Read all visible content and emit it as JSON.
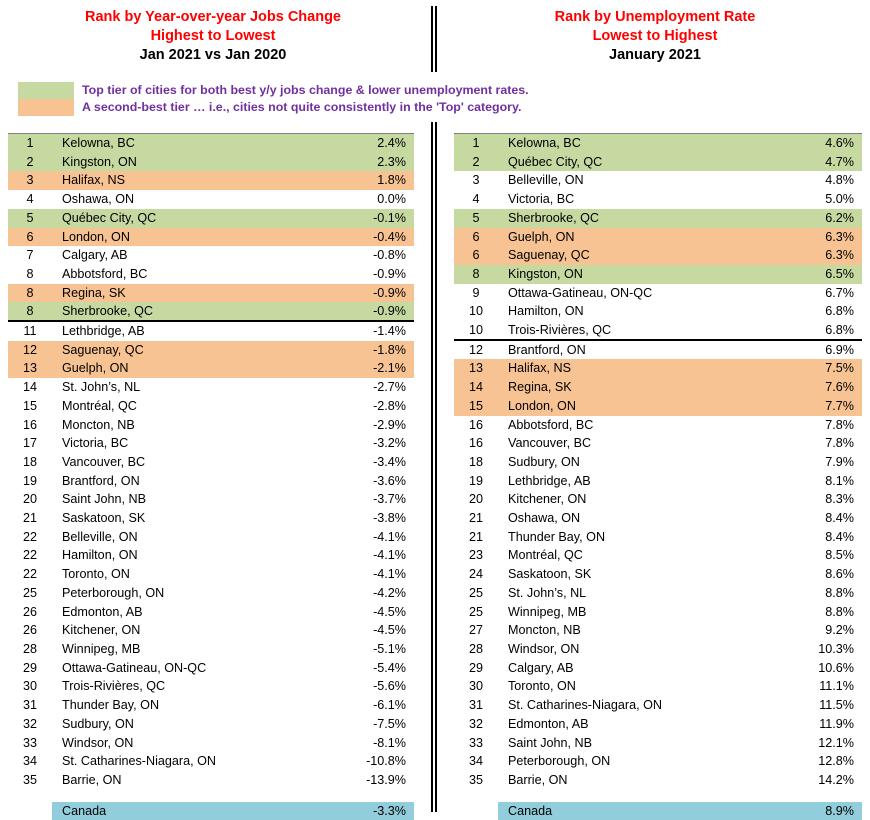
{
  "left_panel": {
    "title_line1": "Rank by Year-over-year Jobs Change",
    "title_line2": "Highest to Lowest",
    "subtitle": "Jan 2021 vs Jan 2020",
    "summary_label": "Canada",
    "summary_value": "-3.3%",
    "rows": [
      {
        "rank": "1",
        "city": "Kelowna, BC",
        "value": "2.4%",
        "tier": "green"
      },
      {
        "rank": "2",
        "city": "Kingston, ON",
        "value": "2.3%",
        "tier": "green"
      },
      {
        "rank": "3",
        "city": "Halifax, NS",
        "value": "1.8%",
        "tier": "orange"
      },
      {
        "rank": "4",
        "city": "Oshawa, ON",
        "value": "0.0%",
        "tier": "none"
      },
      {
        "rank": "5",
        "city": "Québec City, QC",
        "value": "-0.1%",
        "tier": "green"
      },
      {
        "rank": "6",
        "city": "London, ON",
        "value": "-0.4%",
        "tier": "orange"
      },
      {
        "rank": "7",
        "city": "Calgary, AB",
        "value": "-0.8%",
        "tier": "none"
      },
      {
        "rank": "8",
        "city": "Abbotsford, BC",
        "value": "-0.9%",
        "tier": "none"
      },
      {
        "rank": "8",
        "city": "Regina, SK",
        "value": "-0.9%",
        "tier": "orange"
      },
      {
        "rank": "8",
        "city": "Sherbrooke, QC",
        "value": "-0.9%",
        "tier": "green",
        "rule_under": true
      },
      {
        "rank": "11",
        "city": "Lethbridge, AB",
        "value": "-1.4%",
        "tier": "none"
      },
      {
        "rank": "12",
        "city": "Saguenay, QC",
        "value": "-1.8%",
        "tier": "orange"
      },
      {
        "rank": "13",
        "city": "Guelph, ON",
        "value": "-2.1%",
        "tier": "orange"
      },
      {
        "rank": "14",
        "city": "St. John’s, NL",
        "value": "-2.7%",
        "tier": "none"
      },
      {
        "rank": "15",
        "city": "Montréal, QC",
        "value": "-2.8%",
        "tier": "none"
      },
      {
        "rank": "16",
        "city": "Moncton, NB",
        "value": "-2.9%",
        "tier": "none"
      },
      {
        "rank": "17",
        "city": "Victoria, BC",
        "value": "-3.2%",
        "tier": "none"
      },
      {
        "rank": "18",
        "city": "Vancouver, BC",
        "value": "-3.4%",
        "tier": "none"
      },
      {
        "rank": "19",
        "city": "Brantford, ON",
        "value": "-3.6%",
        "tier": "none"
      },
      {
        "rank": "20",
        "city": "Saint John, NB",
        "value": "-3.7%",
        "tier": "none"
      },
      {
        "rank": "21",
        "city": "Saskatoon, SK",
        "value": "-3.8%",
        "tier": "none"
      },
      {
        "rank": "22",
        "city": "Belleville, ON",
        "value": "-4.1%",
        "tier": "none"
      },
      {
        "rank": "22",
        "city": "Hamilton, ON",
        "value": "-4.1%",
        "tier": "none"
      },
      {
        "rank": "22",
        "city": "Toronto, ON",
        "value": "-4.1%",
        "tier": "none"
      },
      {
        "rank": "25",
        "city": "Peterborough, ON",
        "value": "-4.2%",
        "tier": "none"
      },
      {
        "rank": "26",
        "city": "Edmonton, AB",
        "value": "-4.5%",
        "tier": "none"
      },
      {
        "rank": "26",
        "city": "Kitchener, ON",
        "value": "-4.5%",
        "tier": "none"
      },
      {
        "rank": "28",
        "city": "Winnipeg, MB",
        "value": "-5.1%",
        "tier": "none"
      },
      {
        "rank": "29",
        "city": "Ottawa-Gatineau, ON-QC",
        "value": "-5.4%",
        "tier": "none"
      },
      {
        "rank": "30",
        "city": "Trois-Rivières, QC",
        "value": "-5.6%",
        "tier": "none"
      },
      {
        "rank": "31",
        "city": "Thunder Bay, ON",
        "value": "-6.1%",
        "tier": "none"
      },
      {
        "rank": "32",
        "city": "Sudbury, ON",
        "value": "-7.5%",
        "tier": "none"
      },
      {
        "rank": "33",
        "city": "Windsor, ON",
        "value": "-8.1%",
        "tier": "none"
      },
      {
        "rank": "34",
        "city": "St. Catharines-Niagara, ON",
        "value": "-10.8%",
        "tier": "none"
      },
      {
        "rank": "35",
        "city": "Barrie, ON",
        "value": "-13.9%",
        "tier": "none"
      }
    ]
  },
  "right_panel": {
    "title_line1": "Rank by Unemployment Rate",
    "title_line2": "Lowest to Highest",
    "subtitle": "January 2021",
    "summary_label": "Canada",
    "summary_value": "8.9%",
    "rows": [
      {
        "rank": "1",
        "city": "Kelowna, BC",
        "value": "4.6%",
        "tier": "green"
      },
      {
        "rank": "2",
        "city": "Québec City, QC",
        "value": "4.7%",
        "tier": "green"
      },
      {
        "rank": "3",
        "city": "Belleville, ON",
        "value": "4.8%",
        "tier": "none"
      },
      {
        "rank": "4",
        "city": "Victoria, BC",
        "value": "5.0%",
        "tier": "none"
      },
      {
        "rank": "5",
        "city": "Sherbrooke, QC",
        "value": "6.2%",
        "tier": "green"
      },
      {
        "rank": "6",
        "city": "Guelph, ON",
        "value": "6.3%",
        "tier": "orange"
      },
      {
        "rank": "6",
        "city": "Saguenay, QC",
        "value": "6.3%",
        "tier": "orange"
      },
      {
        "rank": "8",
        "city": "Kingston, ON",
        "value": "6.5%",
        "tier": "green"
      },
      {
        "rank": "9",
        "city": "Ottawa-Gatineau, ON-QC",
        "value": "6.7%",
        "tier": "none"
      },
      {
        "rank": "10",
        "city": "Hamilton, ON",
        "value": "6.8%",
        "tier": "none"
      },
      {
        "rank": "10",
        "city": "Trois-Rivières, QC",
        "value": "6.8%",
        "tier": "none",
        "rule_under": true
      },
      {
        "rank": "12",
        "city": "Brantford, ON",
        "value": "6.9%",
        "tier": "none"
      },
      {
        "rank": "13",
        "city": "Halifax, NS",
        "value": "7.5%",
        "tier": "orange"
      },
      {
        "rank": "14",
        "city": "Regina, SK",
        "value": "7.6%",
        "tier": "orange"
      },
      {
        "rank": "15",
        "city": "London, ON",
        "value": "7.7%",
        "tier": "orange"
      },
      {
        "rank": "16",
        "city": "Abbotsford, BC",
        "value": "7.8%",
        "tier": "none"
      },
      {
        "rank": "16",
        "city": "Vancouver, BC",
        "value": "7.8%",
        "tier": "none"
      },
      {
        "rank": "18",
        "city": "Sudbury, ON",
        "value": "7.9%",
        "tier": "none"
      },
      {
        "rank": "19",
        "city": "Lethbridge, AB",
        "value": "8.1%",
        "tier": "none"
      },
      {
        "rank": "20",
        "city": "Kitchener, ON",
        "value": "8.3%",
        "tier": "none"
      },
      {
        "rank": "21",
        "city": "Oshawa, ON",
        "value": "8.4%",
        "tier": "none"
      },
      {
        "rank": "21",
        "city": "Thunder Bay, ON",
        "value": "8.4%",
        "tier": "none"
      },
      {
        "rank": "23",
        "city": "Montréal, QC",
        "value": "8.5%",
        "tier": "none"
      },
      {
        "rank": "24",
        "city": "Saskatoon, SK",
        "value": "8.6%",
        "tier": "none"
      },
      {
        "rank": "25",
        "city": "St. John’s, NL",
        "value": "8.8%",
        "tier": "none"
      },
      {
        "rank": "25",
        "city": "Winnipeg, MB",
        "value": "8.8%",
        "tier": "none"
      },
      {
        "rank": "27",
        "city": "Moncton, NB",
        "value": "9.2%",
        "tier": "none"
      },
      {
        "rank": "28",
        "city": "Windsor, ON",
        "value": "10.3%",
        "tier": "none"
      },
      {
        "rank": "29",
        "city": "Calgary, AB",
        "value": "10.6%",
        "tier": "none"
      },
      {
        "rank": "30",
        "city": "Toronto, ON",
        "value": "11.1%",
        "tier": "none"
      },
      {
        "rank": "31",
        "city": "St. Catharines-Niagara, ON",
        "value": "11.5%",
        "tier": "none"
      },
      {
        "rank": "32",
        "city": "Edmonton, AB",
        "value": "11.9%",
        "tier": "none"
      },
      {
        "rank": "33",
        "city": "Saint John, NB",
        "value": "12.1%",
        "tier": "none"
      },
      {
        "rank": "34",
        "city": "Peterborough, ON",
        "value": "12.8%",
        "tier": "none"
      },
      {
        "rank": "35",
        "city": "Barrie, ON",
        "value": "14.2%",
        "tier": "none"
      }
    ]
  },
  "legend": {
    "items": [
      {
        "swatch": "green",
        "text": "Top tier of cities for both best y/y jobs change & lower unemployment rates."
      },
      {
        "swatch": "orange",
        "text": "A second-best tier … i.e., cities not quite consistently in the 'Top' category."
      }
    ]
  },
  "colors": {
    "tier_green": "#c5d9a1",
    "tier_orange": "#f8c393",
    "summary_blue": "#92cddc",
    "title_red": "#ff0000",
    "legend_purple": "#7030a0"
  }
}
